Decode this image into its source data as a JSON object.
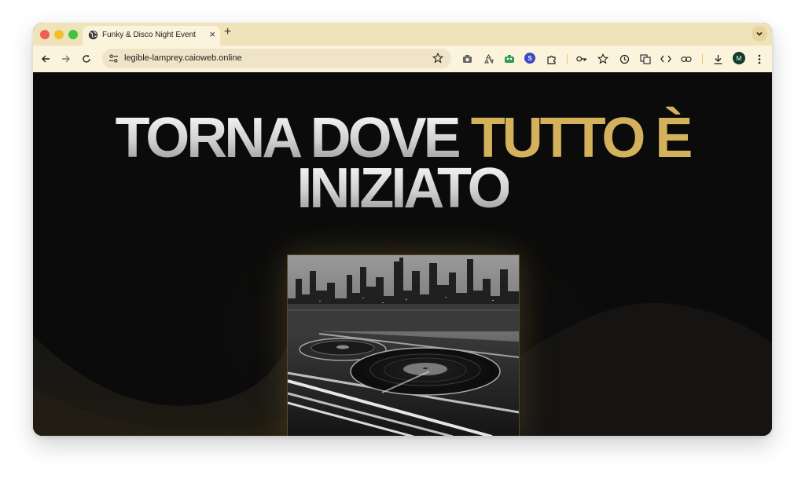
{
  "browser": {
    "tab": {
      "title": "Funky & Disco Night Event"
    },
    "address": {
      "url": "legible-lamprey.caioweb.online"
    },
    "profile_initial": "M",
    "extension_badge": "S"
  },
  "page": {
    "hero": {
      "line1_part1": "TORNA DOVE ",
      "line1_part2": "TUTTO È",
      "line2": "INIZIATO"
    },
    "colors": {
      "accent_gold": "#d4b25c",
      "background": "#0b0b0b",
      "tabstrip": "#efe3b9",
      "toolbar": "#fbf3dc"
    }
  },
  "icons": [
    "globe-icon",
    "close-icon",
    "plus-icon",
    "chevron-down-icon",
    "back-arrow-icon",
    "forward-arrow-icon",
    "reload-icon",
    "site-info-icon",
    "star-icon",
    "camera-icon",
    "recycle-icon",
    "extension-icon",
    "puzzle-icon",
    "key-icon",
    "star-plus-icon",
    "history-icon",
    "translate-icon",
    "code-icon",
    "link-icon",
    "download-icon",
    "menu-icon"
  ]
}
